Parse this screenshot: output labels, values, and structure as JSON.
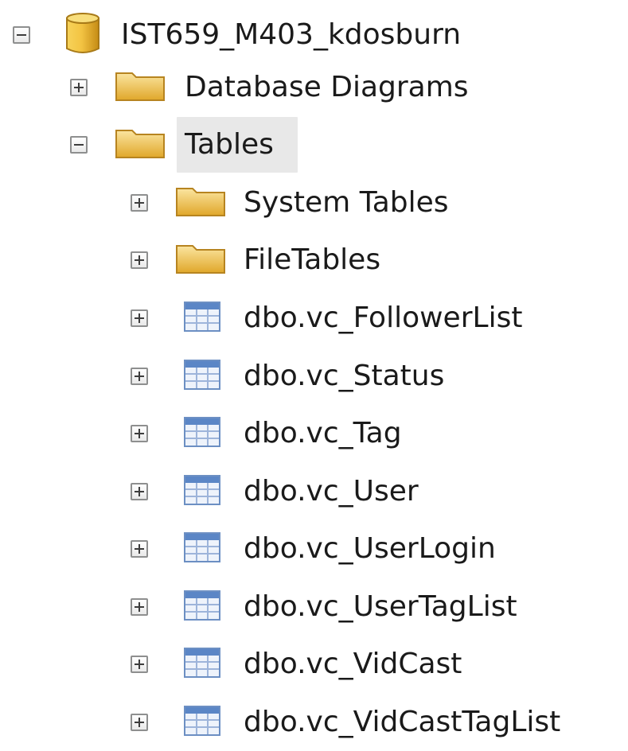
{
  "tree": {
    "database": {
      "label": "IST659_M403_kdosburn",
      "expanded": true
    },
    "database_diagrams": {
      "label": "Database Diagrams",
      "expanded": false
    },
    "tables": {
      "label": "Tables",
      "expanded": true,
      "selected": true
    },
    "system_tables": {
      "label": "System Tables",
      "expanded": false
    },
    "file_tables": {
      "label": "FileTables",
      "expanded": false
    },
    "table_items": [
      {
        "label": "dbo.vc_FollowerList"
      },
      {
        "label": "dbo.vc_Status"
      },
      {
        "label": "dbo.vc_Tag"
      },
      {
        "label": "dbo.vc_User"
      },
      {
        "label": "dbo.vc_UserLogin"
      },
      {
        "label": "dbo.vc_UserTagList"
      },
      {
        "label": "dbo.vc_VidCast"
      },
      {
        "label": "dbo.vc_VidCastTagList"
      }
    ]
  },
  "colors": {
    "folder": "#e9b93a",
    "database": "#e8b13a",
    "table_icon": "#5b86c6",
    "selection": "#e8e8e8"
  },
  "icons": {
    "database": "database-icon",
    "folder": "folder-icon",
    "table": "table-icon"
  }
}
